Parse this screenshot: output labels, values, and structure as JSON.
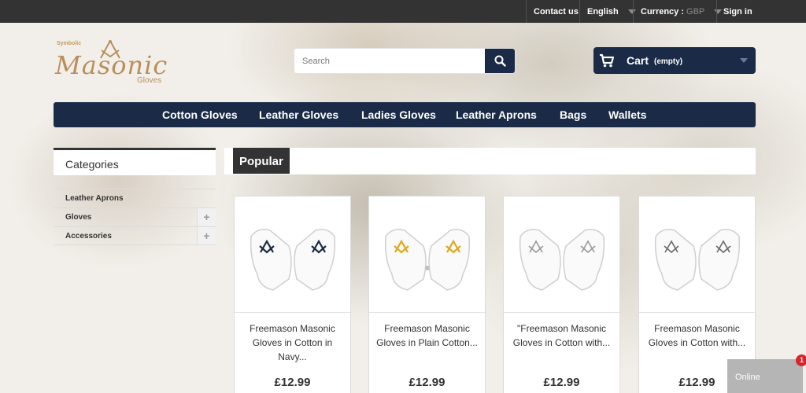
{
  "topbar": {
    "contact": "Contact us",
    "language": "English",
    "currency_label": "Currency :",
    "currency_value": "GBP",
    "signin": "Sign in"
  },
  "logo": {
    "line1": "Symbolic",
    "line2": "Masonic",
    "line3": "Gloves"
  },
  "search": {
    "placeholder": "Search",
    "icon": "search-icon"
  },
  "cart": {
    "label": "Cart",
    "status": "(empty)",
    "icon": "shopping-cart-icon"
  },
  "menu": [
    "Cotton Gloves",
    "Leather Gloves",
    "Ladies Gloves",
    "Leather Aprons",
    "Bags",
    "Wallets"
  ],
  "sidebar": {
    "title": "Categories",
    "items": [
      {
        "label": "Leather Aprons",
        "expandable": false
      },
      {
        "label": "Gloves",
        "expandable": true,
        "toggle": "+"
      },
      {
        "label": "Accessories",
        "expandable": true,
        "toggle": "+"
      }
    ]
  },
  "popular": {
    "tab": "Popular",
    "products": [
      {
        "title": "Freemason Masonic Gloves in Cotton in Navy...",
        "price": "£12.99",
        "emblem_color": "#1b2b47"
      },
      {
        "title": "Freemason Masonic Gloves in Plain Cotton...",
        "price": "£12.99",
        "emblem_color": "#e0a820"
      },
      {
        "title": "\"Freemason Masonic Gloves in Cotton with...",
        "price": "£12.99",
        "emblem_color": "#9a9a9a"
      },
      {
        "title": "Freemason Masonic Gloves in Cotton with...",
        "price": "£12.99",
        "emblem_color": "#6a6a6a"
      }
    ]
  },
  "chat": {
    "status": "Online",
    "badge": "1"
  },
  "colors": {
    "navy": "#1b2b47",
    "topbar": "#333333",
    "logo_gold": "#b98f5b"
  }
}
